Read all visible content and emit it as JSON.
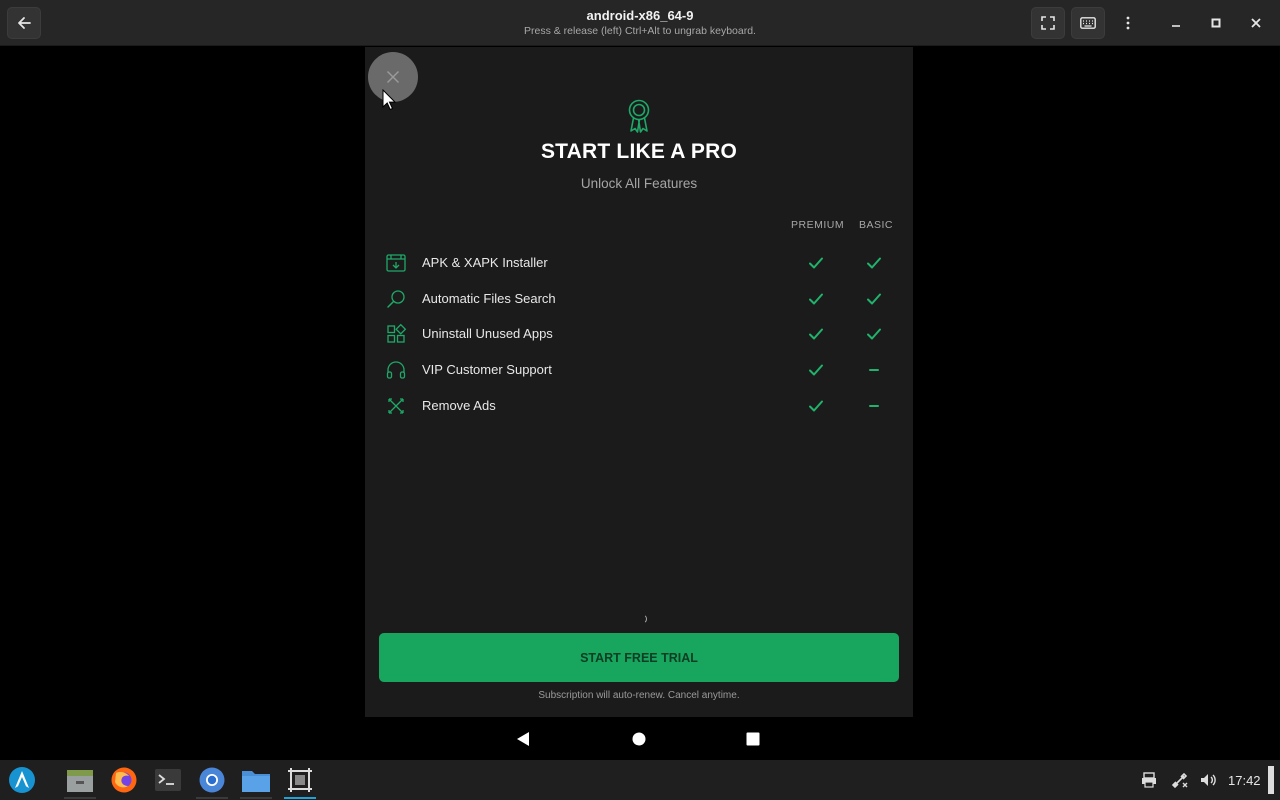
{
  "window": {
    "title": "android-x86_64-9",
    "subtitle": "Press & release (left) Ctrl+Alt to ungrab keyboard."
  },
  "paywall": {
    "headline": "START LIKE A PRO",
    "subhead": "Unlock All Features",
    "columns": {
      "premium": "PREMIUM",
      "basic": "BASIC"
    },
    "features": [
      {
        "label": "APK & XAPK Installer",
        "icon": "installer-icon",
        "premium": "check",
        "basic": "check"
      },
      {
        "label": "Automatic Files Search",
        "icon": "search-icon",
        "premium": "check",
        "basic": "check"
      },
      {
        "label": "Uninstall Unused Apps",
        "icon": "apps-grid-icon",
        "premium": "check",
        "basic": "check"
      },
      {
        "label": "VIP Customer Support",
        "icon": "headset-icon",
        "premium": "check",
        "basic": "dash"
      },
      {
        "label": "Remove Ads",
        "icon": "remove-ads-icon",
        "premium": "check",
        "basic": "dash"
      }
    ],
    "cta_label": "START FREE TRIAL",
    "fine_print": "Subscription will auto-renew. Cancel anytime."
  },
  "taskbar": {
    "clock": "17:42"
  },
  "colors": {
    "accent": "#18a65f",
    "check": "#21b36c",
    "panel_bg": "#1b1b1b",
    "active_indicator": "#1fa3d6"
  }
}
